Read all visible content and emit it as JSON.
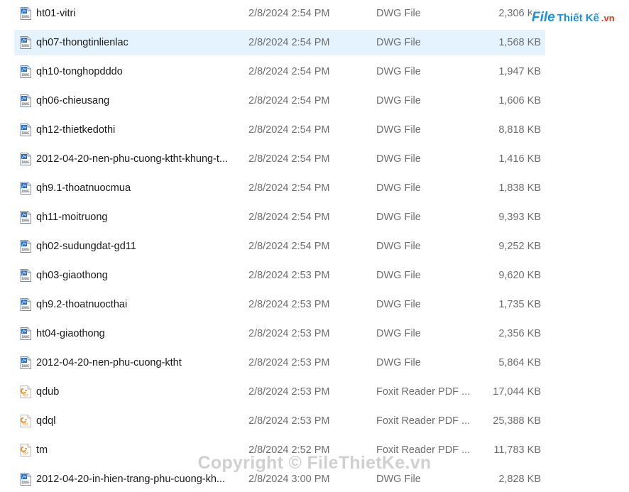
{
  "files": [
    {
      "name": "ht01-vitri",
      "date": "2/8/2024 2:54 PM",
      "type": "DWG File",
      "size": "2,306 KB",
      "icon": "dwg-file-icon"
    },
    {
      "name": "qh07-thongtinlienlac",
      "date": "2/8/2024 2:54 PM",
      "type": "DWG File",
      "size": "1,568 KB",
      "icon": "dwg-file-icon",
      "selected": true
    },
    {
      "name": "qh10-tonghopdddo",
      "date": "2/8/2024 2:54 PM",
      "type": "DWG File",
      "size": "1,947 KB",
      "icon": "dwg-file-icon"
    },
    {
      "name": "qh06-chieusang",
      "date": "2/8/2024 2:54 PM",
      "type": "DWG File",
      "size": "1,606 KB",
      "icon": "dwg-file-icon"
    },
    {
      "name": "qh12-thietkedothi",
      "date": "2/8/2024 2:54 PM",
      "type": "DWG File",
      "size": "8,818 KB",
      "icon": "dwg-file-icon"
    },
    {
      "name": "2012-04-20-nen-phu-cuong-ktht-khung-t...",
      "date": "2/8/2024 2:54 PM",
      "type": "DWG File",
      "size": "1,416 KB",
      "icon": "dwg-file-icon"
    },
    {
      "name": "qh9.1-thoatnuocmua",
      "date": "2/8/2024 2:54 PM",
      "type": "DWG File",
      "size": "1,838 KB",
      "icon": "dwg-file-icon"
    },
    {
      "name": "qh11-moitruong",
      "date": "2/8/2024 2:54 PM",
      "type": "DWG File",
      "size": "9,393 KB",
      "icon": "dwg-file-icon"
    },
    {
      "name": "qh02-sudungdat-gd11",
      "date": "2/8/2024 2:54 PM",
      "type": "DWG File",
      "size": "9,252 KB",
      "icon": "dwg-file-icon"
    },
    {
      "name": "qh03-giaothong",
      "date": "2/8/2024 2:53 PM",
      "type": "DWG File",
      "size": "9,620 KB",
      "icon": "dwg-file-icon"
    },
    {
      "name": "qh9.2-thoatnuocthai",
      "date": "2/8/2024 2:53 PM",
      "type": "DWG File",
      "size": "1,735 KB",
      "icon": "dwg-file-icon"
    },
    {
      "name": "ht04-giaothong",
      "date": "2/8/2024 2:53 PM",
      "type": "DWG File",
      "size": "2,356 KB",
      "icon": "dwg-file-icon"
    },
    {
      "name": "2012-04-20-nen-phu-cuong-ktht",
      "date": "2/8/2024 2:53 PM",
      "type": "DWG File",
      "size": "5,864 KB",
      "icon": "dwg-file-icon"
    },
    {
      "name": "qdub",
      "date": "2/8/2024 2:53 PM",
      "type": "Foxit Reader PDF ...",
      "size": "17,044 KB",
      "icon": "pdf-file-icon"
    },
    {
      "name": "qdql",
      "date": "2/8/2024 2:53 PM",
      "type": "Foxit Reader PDF ...",
      "size": "25,388 KB",
      "icon": "pdf-file-icon"
    },
    {
      "name": "tm",
      "date": "2/8/2024 2:52 PM",
      "type": "Foxit Reader PDF ...",
      "size": "11,783 KB",
      "icon": "pdf-file-icon"
    },
    {
      "name": "2012-04-20-in-hien-trang-phu-cuong-kh...",
      "date": "2/8/2024 3:00 PM",
      "type": "DWG File",
      "size": "2,828 KB",
      "icon": "dwg-file-icon"
    }
  ],
  "logo": {
    "file": "File",
    "thietke": "Thiết Kế",
    "vn": ".vn"
  },
  "watermark": "Copyright © FileThietKe.vn",
  "colors": {
    "selected_row": "#e5f3ff",
    "secondary_text": "#6d6d6d",
    "dwg_accent": "#2a6fc2",
    "pdf_accent": "#e8912a"
  }
}
